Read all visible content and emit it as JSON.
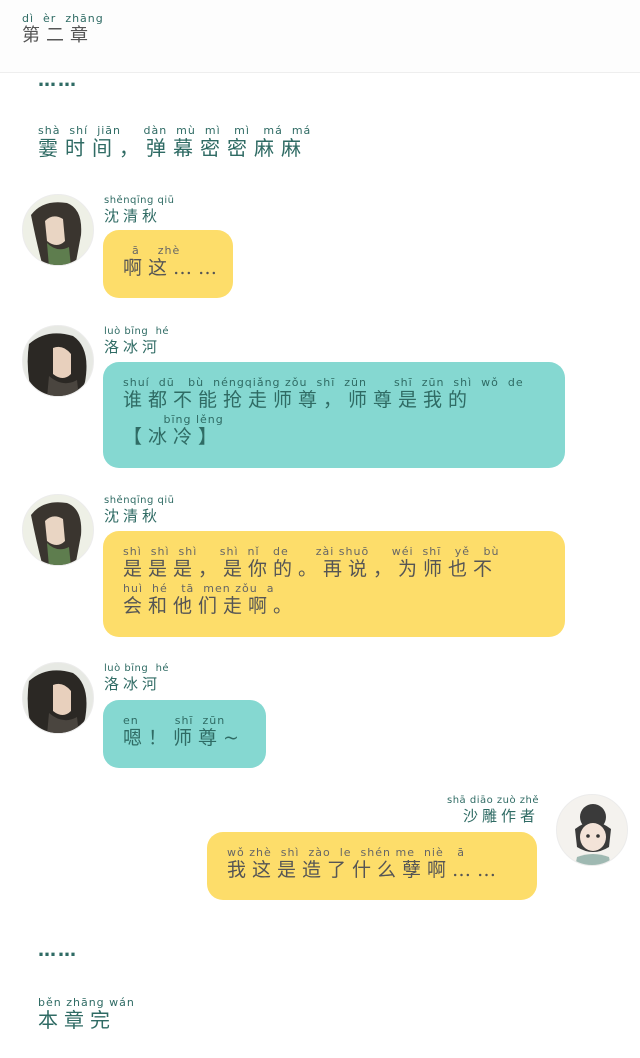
{
  "header": {
    "pinyin": "dì  èr  zhāng",
    "title": "第二章"
  },
  "intro": {
    "ellipsis": "……",
    "pinyin": "shà  shí  jiān     dàn  mù  mì   mì   má  má",
    "text": "霎时间，弹幕密密麻麻"
  },
  "messages": [
    {
      "speaker_pinyin": "shěnqīng qiū",
      "speaker": "沈清秋",
      "avatar_icon": "shen-qingqiu-avatar",
      "color": "#fddd6a",
      "lines": [
        {
          "pinyin": "  ā    zhè",
          "text": "啊这……"
        }
      ]
    },
    {
      "speaker_pinyin": "luò bīng  hé",
      "speaker": "洛冰河",
      "avatar_icon": "luo-binghe-avatar",
      "color": "#85d8d1",
      "lines": [
        {
          "pinyin": "shuí  dū   bù  néngqiǎng zǒu  shī  zūn      shī  zūn  shì  wǒ  de",
          "text": "谁都不能抢走师尊，师尊是我的"
        },
        {
          "pinyin": "         bīng lěng",
          "text": "【冰冷】"
        }
      ]
    },
    {
      "speaker_pinyin": "shěnqīng qiū",
      "speaker": "沈清秋",
      "avatar_icon": "shen-qingqiu-avatar",
      "color": "#fddd6a",
      "lines": [
        {
          "pinyin": "shì  shì  shì     shì  nǐ   de      zài shuō     wéi  shī   yě   bù",
          "text": "是是是，是你的。再说，为师也不"
        },
        {
          "pinyin": "huì  hé   tā  men zǒu  a",
          "text": "会和他们走啊。"
        }
      ]
    },
    {
      "speaker_pinyin": "luò bīng  hé",
      "speaker": "洛冰河",
      "avatar_icon": "luo-binghe-avatar",
      "color": "#85d8d1",
      "lines": [
        {
          "pinyin": "en        shī  zūn",
          "text": "嗯！师尊~"
        }
      ]
    },
    {
      "speaker_pinyin": "shā diāo zuò zhě",
      "speaker": "沙雕作者",
      "avatar_icon": "author-avatar",
      "color": "#fddd6a",
      "lines": [
        {
          "pinyin": "wǒ zhè  shì  zào  le  shén me  niè   ā",
          "text": "我这是造了什么孽啊……"
        }
      ]
    }
  ],
  "outro": {
    "ellipsis": "……",
    "pinyin": "běn zhāng wán",
    "text": "本章完"
  }
}
